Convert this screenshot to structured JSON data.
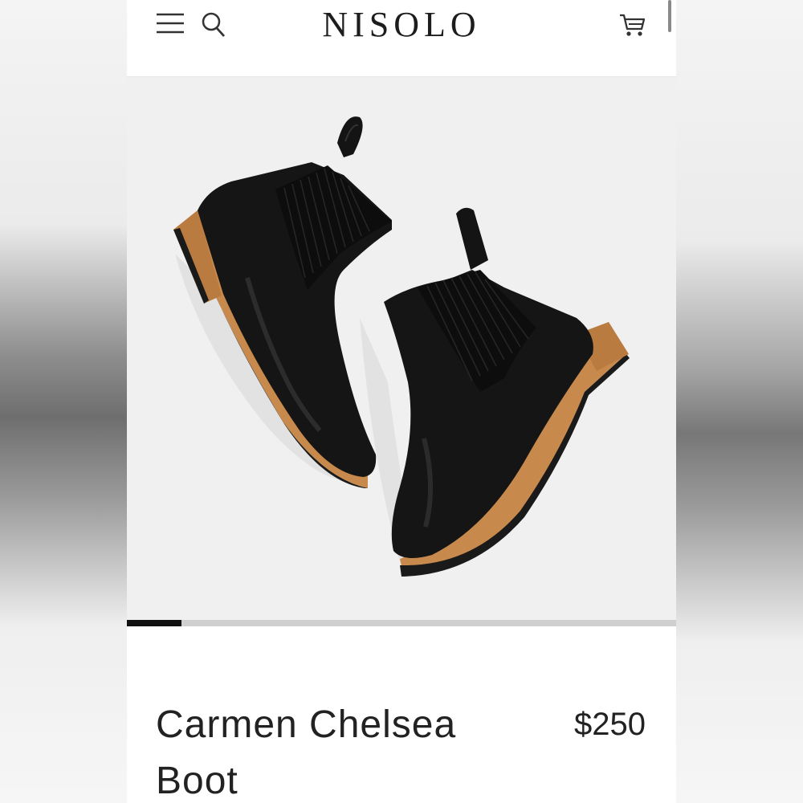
{
  "header": {
    "brand": "NISOLO",
    "menu_icon": "hamburger-menu-icon",
    "search_icon": "search-icon",
    "cart_icon": "shopping-cart-icon"
  },
  "gallery": {
    "image_alt": "Carmen Chelsea Boot",
    "current_slide_fraction": 0.1
  },
  "product": {
    "title": "Carmen Chelsea Boot",
    "price": "$250"
  },
  "colors": {
    "text": "#222222",
    "progress_active": "#111111",
    "progress_track": "#cfcfcf",
    "sole": "#c88a4c",
    "leather": "#151515"
  }
}
